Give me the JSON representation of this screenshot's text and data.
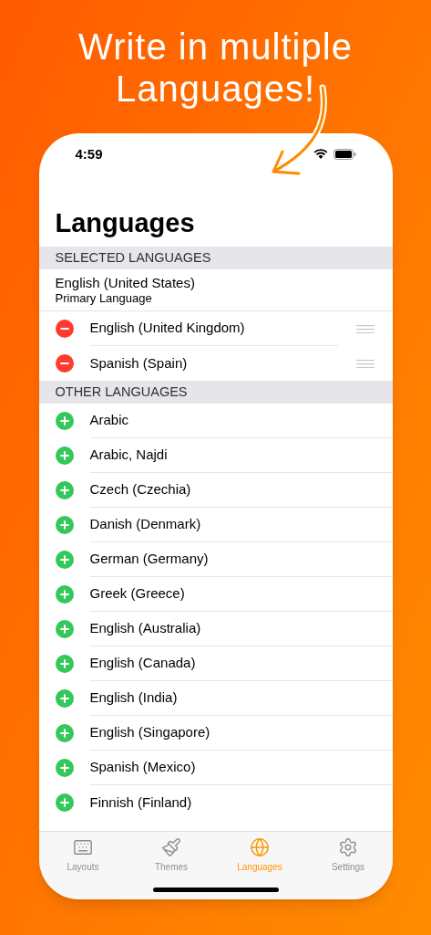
{
  "headline": [
    "Write in multiple",
    "Languages!"
  ],
  "status_bar": {
    "time": "4:59"
  },
  "title": "Languages",
  "sections": [
    {
      "header": "SELECTED LANGUAGES",
      "primary": {
        "name": "English (United States)",
        "subtitle": "Primary Language"
      },
      "rows": [
        {
          "kind": "remove",
          "name": "English (United Kingdom)"
        },
        {
          "kind": "remove",
          "name": "Spanish (Spain)"
        }
      ]
    },
    {
      "header": "OTHER LANGUAGES",
      "rows": [
        {
          "kind": "add",
          "name": "Arabic"
        },
        {
          "kind": "add",
          "name": "Arabic, Najdi"
        },
        {
          "kind": "add",
          "name": "Czech (Czechia)"
        },
        {
          "kind": "add",
          "name": "Danish (Denmark)"
        },
        {
          "kind": "add",
          "name": "German (Germany)"
        },
        {
          "kind": "add",
          "name": "Greek (Greece)"
        },
        {
          "kind": "add",
          "name": "English (Australia)"
        },
        {
          "kind": "add",
          "name": "English (Canada)"
        },
        {
          "kind": "add",
          "name": "English (India)"
        },
        {
          "kind": "add",
          "name": "English (Singapore)"
        },
        {
          "kind": "add",
          "name": "Spanish (Mexico)"
        },
        {
          "kind": "add",
          "name": "Finnish (Finland)"
        }
      ]
    }
  ],
  "tabs": [
    {
      "kind": "layouts",
      "label": "Layouts",
      "selected": false
    },
    {
      "kind": "themes",
      "label": "Themes",
      "selected": false
    },
    {
      "kind": "languages",
      "label": "Languages",
      "selected": true
    },
    {
      "kind": "settings",
      "label": "Settings",
      "selected": false
    }
  ]
}
